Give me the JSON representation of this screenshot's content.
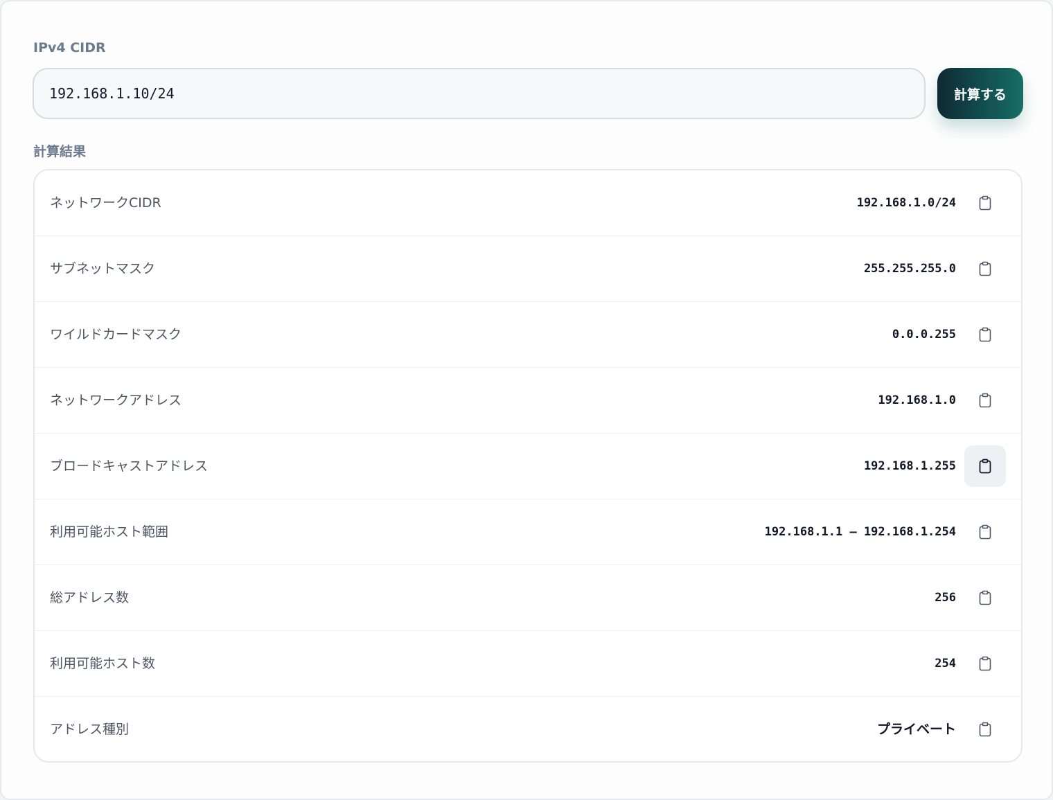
{
  "form": {
    "label": "IPv4 CIDR",
    "input_value": "192.168.1.10/24",
    "submit_label": "計算する"
  },
  "results": {
    "title": "計算結果",
    "copy_icon": "clipboard-icon",
    "rows": [
      {
        "label": "ネットワークCIDR",
        "value": "192.168.1.0/24"
      },
      {
        "label": "サブネットマスク",
        "value": "255.255.255.0"
      },
      {
        "label": "ワイルドカードマスク",
        "value": "0.0.0.255"
      },
      {
        "label": "ネットワークアドレス",
        "value": "192.168.1.0"
      },
      {
        "label": "ブロードキャストアドレス",
        "value": "192.168.1.255"
      },
      {
        "label": "利用可能ホスト範囲",
        "value": "192.168.1.1 – 192.168.1.254"
      },
      {
        "label": "総アドレス数",
        "value": "256"
      },
      {
        "label": "利用可能ホスト数",
        "value": "254"
      },
      {
        "label": "アドレス種別",
        "value": "プライベート"
      }
    ]
  },
  "colors": {
    "accent_start": "#0e2a33",
    "accent_end": "#176e66"
  }
}
